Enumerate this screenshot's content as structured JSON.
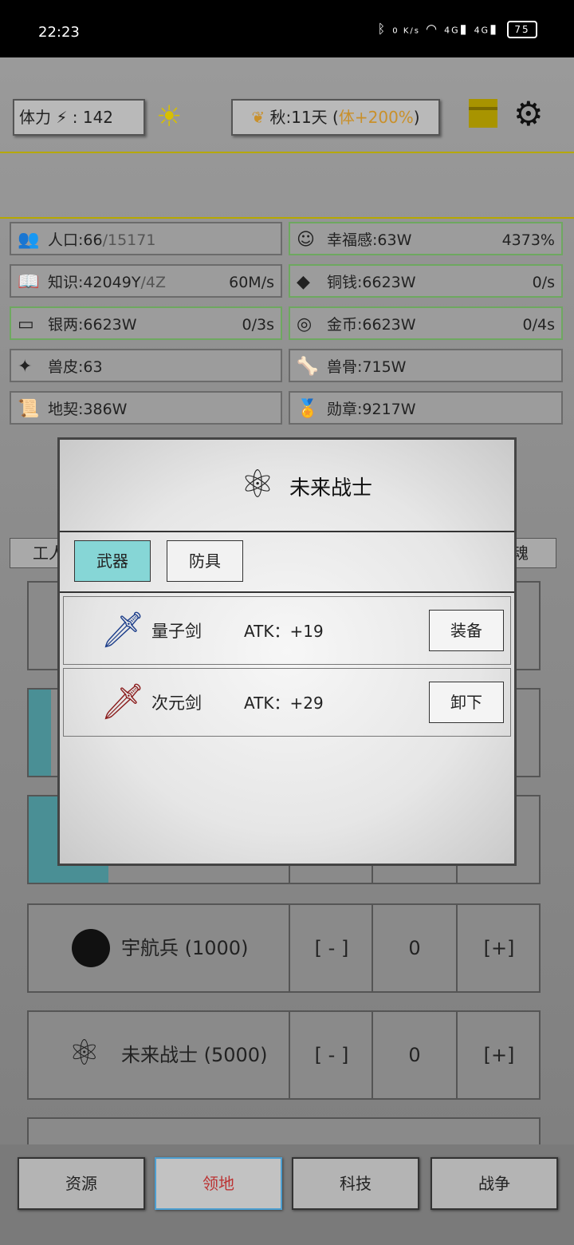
{
  "status": {
    "time": "22:23",
    "net_speed": "0 K/s",
    "signal1": "4G",
    "signal2": "4G",
    "battery": "75"
  },
  "header": {
    "energy_label": "体力",
    "energy_value": "142",
    "season_label": "秋:11天 (",
    "season_bonus": "体+200%",
    "season_close": ")"
  },
  "resources": [
    {
      "icon": "👥",
      "label": "人口:66",
      "extra": "/15171",
      "rate": ""
    },
    {
      "icon": "☺",
      "label": "幸福感:63W",
      "extra": "",
      "rate": "4373%"
    },
    {
      "icon": "📖",
      "label": "知识:42049Y",
      "extra": "/4Z",
      "rate": "60M/s"
    },
    {
      "icon": "◆",
      "label": "铜钱:6623W",
      "extra": "",
      "rate": "0/s"
    },
    {
      "icon": "▭",
      "label": "银两:6623W",
      "extra": "",
      "rate": "0/3s"
    },
    {
      "icon": "◎",
      "label": "金币:6623W",
      "extra": "",
      "rate": "0/4s"
    },
    {
      "icon": "✦",
      "label": "兽皮:63",
      "extra": "",
      "rate": ""
    },
    {
      "icon": "🦴",
      "label": "兽骨:715W",
      "extra": "",
      "rate": ""
    },
    {
      "icon": "📜",
      "label": "地契:386W",
      "extra": "",
      "rate": ""
    },
    {
      "icon": "🏅",
      "label": "勋章:9217W",
      "extra": "",
      "rate": ""
    }
  ],
  "side_tabs": {
    "left": "工人",
    "right": "魂"
  },
  "units": [
    {
      "name": "宇航兵 (1000)",
      "minus": "[ - ]",
      "count": "0",
      "plus": "[+]"
    },
    {
      "name": "未来战士 (5000)",
      "minus": "[ - ]",
      "count": "0",
      "plus": "[+]"
    }
  ],
  "modal": {
    "title": "未来战士",
    "tabs": [
      "武器",
      "防具"
    ],
    "items": [
      {
        "name": "量子剑",
        "atk": "ATK：+19",
        "action": "装备"
      },
      {
        "name": "次元剑",
        "atk": "ATK：+29",
        "action": "卸下"
      }
    ]
  },
  "nav": [
    "资源",
    "领地",
    "科技",
    "战争"
  ]
}
